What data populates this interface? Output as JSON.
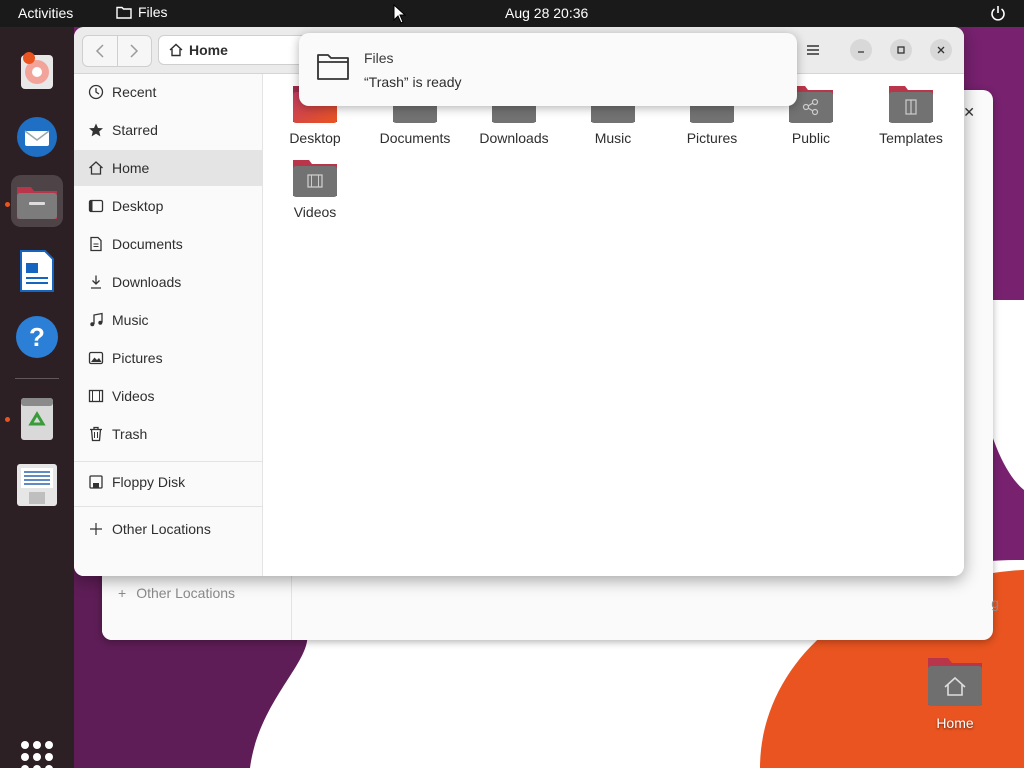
{
  "topbar": {
    "activities": "Activities",
    "app_name": "Files",
    "clock": "Aug 28  20:36"
  },
  "dock": {
    "items": [
      "rhythmbox-icon",
      "thunderbird-icon",
      "files-icon",
      "libreoffice-writer-icon",
      "help-icon",
      "trash-icon",
      "floppy-disk-icon"
    ],
    "accent_color": "#e95420"
  },
  "window": {
    "path_label": "Home",
    "sidebar": {
      "items": [
        {
          "label": "Recent",
          "icon": "clock-icon"
        },
        {
          "label": "Starred",
          "icon": "star-icon"
        },
        {
          "label": "Home",
          "icon": "home-icon",
          "selected": true
        },
        {
          "label": "Desktop",
          "icon": "desktop-icon"
        },
        {
          "label": "Documents",
          "icon": "document-icon"
        },
        {
          "label": "Downloads",
          "icon": "download-icon"
        },
        {
          "label": "Music",
          "icon": "music-icon"
        },
        {
          "label": "Pictures",
          "icon": "picture-icon"
        },
        {
          "label": "Videos",
          "icon": "video-icon"
        },
        {
          "label": "Trash",
          "icon": "trash-icon"
        }
      ],
      "devices": [
        {
          "label": "Floppy Disk",
          "icon": "floppy-icon"
        }
      ],
      "other": {
        "label": "Other Locations",
        "icon": "plus-icon"
      }
    },
    "folders": [
      {
        "name": "Desktop",
        "icon": "folder-desktop-icon"
      },
      {
        "name": "Documents",
        "icon": "folder-documents-icon"
      },
      {
        "name": "Downloads",
        "icon": "folder-downloads-icon"
      },
      {
        "name": "Music",
        "icon": "folder-music-icon"
      },
      {
        "name": "Pictures",
        "icon": "folder-pictures-icon"
      },
      {
        "name": "Public",
        "icon": "folder-public-icon"
      },
      {
        "name": "Templates",
        "icon": "folder-templates-icon"
      },
      {
        "name": "Videos",
        "icon": "folder-videos-icon"
      }
    ]
  },
  "notification": {
    "title": "Files",
    "body": "“Trash” is ready"
  },
  "background_window": {
    "other_locations": "Other Locations",
    "partial_text": "g"
  },
  "desktop": {
    "home_label": "Home"
  },
  "colors": {
    "folder_top": "#b9364a",
    "folder_body": "#6f6f6f",
    "orange": "#e95420",
    "purple": "#77216f"
  }
}
